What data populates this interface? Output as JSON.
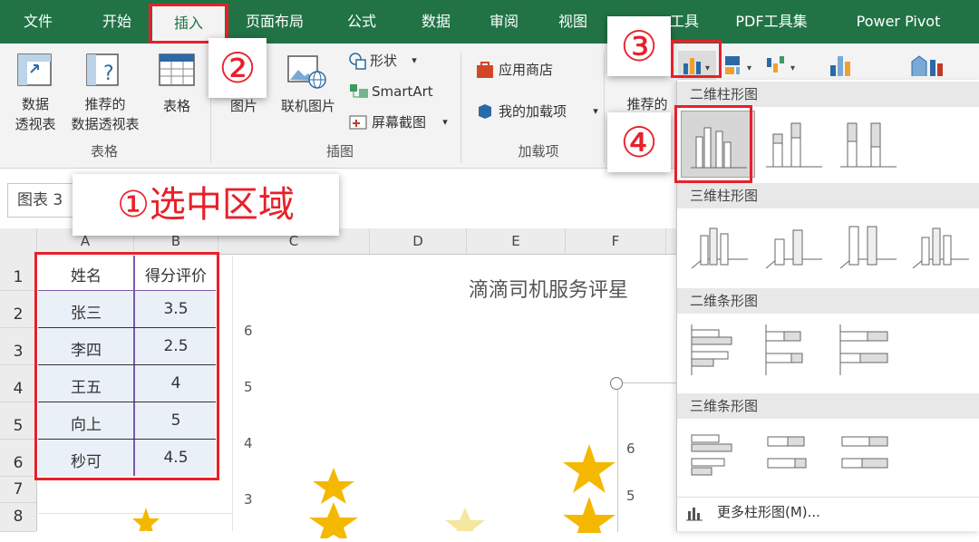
{
  "menu": {
    "items": [
      "文件",
      "开始",
      "插入",
      "页面布局",
      "公式",
      "数据",
      "审阅",
      "视图",
      "工具",
      "PDF工具集",
      "Power Pivot"
    ],
    "active": "插入"
  },
  "ribbon": {
    "pivot_label1": "数据",
    "pivot_label2": "透视表",
    "rec_pivot_label1": "推荐的",
    "rec_pivot_label2": "数据透视表",
    "table_label": "表格",
    "group_table": "表格",
    "picture_label": "图片",
    "online_picture_label": "联机图片",
    "shapes_label": "形状",
    "smartart_label": "SmartArt",
    "screenshot_label": "屏幕截图",
    "group_illustrations": "插图",
    "store_label": "应用商店",
    "my_addins_label": "我的加载项",
    "group_addins": "加载项",
    "recommended_chart_partial": "推荐的"
  },
  "namebox": {
    "value": "图表 3"
  },
  "columns": [
    "A",
    "B",
    "C",
    "D",
    "E",
    "F"
  ],
  "rows": [
    "1",
    "2",
    "3",
    "4",
    "5",
    "6",
    "7",
    "8"
  ],
  "table": {
    "headers": [
      "姓名",
      "得分评价"
    ],
    "rows": [
      [
        "张三",
        "3.5"
      ],
      [
        "李四",
        "2.5"
      ],
      [
        "王五",
        "4"
      ],
      [
        "向上",
        "5"
      ],
      [
        "秒可",
        "4.5"
      ]
    ]
  },
  "chart": {
    "title": "滴滴司机服务评星",
    "y_ticks": [
      "6",
      "5",
      "4",
      "3"
    ],
    "inner_y_ticks": [
      "6",
      "5"
    ]
  },
  "gallery": {
    "sec1": "二维柱形图",
    "sec2": "三维柱形图",
    "sec3": "二维条形图",
    "sec4": "三维条形图",
    "more": "更多柱形图(M)..."
  },
  "annotations": {
    "step1": "①选中区域",
    "step2": "②",
    "step3": "③",
    "step4": "④"
  },
  "colors": {
    "excel_green": "#217346",
    "annotation_red": "#e8202a",
    "star_gold": "#f5b800"
  }
}
